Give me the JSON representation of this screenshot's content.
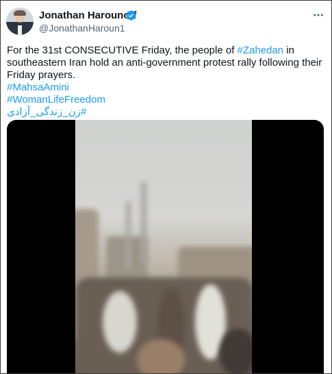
{
  "tweet": {
    "author_name": "Jonathan Harounoff",
    "handle": "@JonathanHaroun1",
    "verified": true,
    "accent_color": "#1d9bf0",
    "text_parts": [
      "For the 31st CONSECUTIVE Friday, the people of ",
      "#Zahedan",
      " in southeastern Iran hold an anti-government protest rally following their Friday prayers."
    ],
    "hashtags": [
      "#MahsaAmini",
      "#WomanLifeFreedom",
      "#زن_زندگی_آزادی"
    ],
    "media": {
      "type": "video",
      "icon": "video-thumbnail"
    }
  },
  "icons": {
    "more": "more-horizontal-icon",
    "verified": "verified-badge-icon"
  }
}
